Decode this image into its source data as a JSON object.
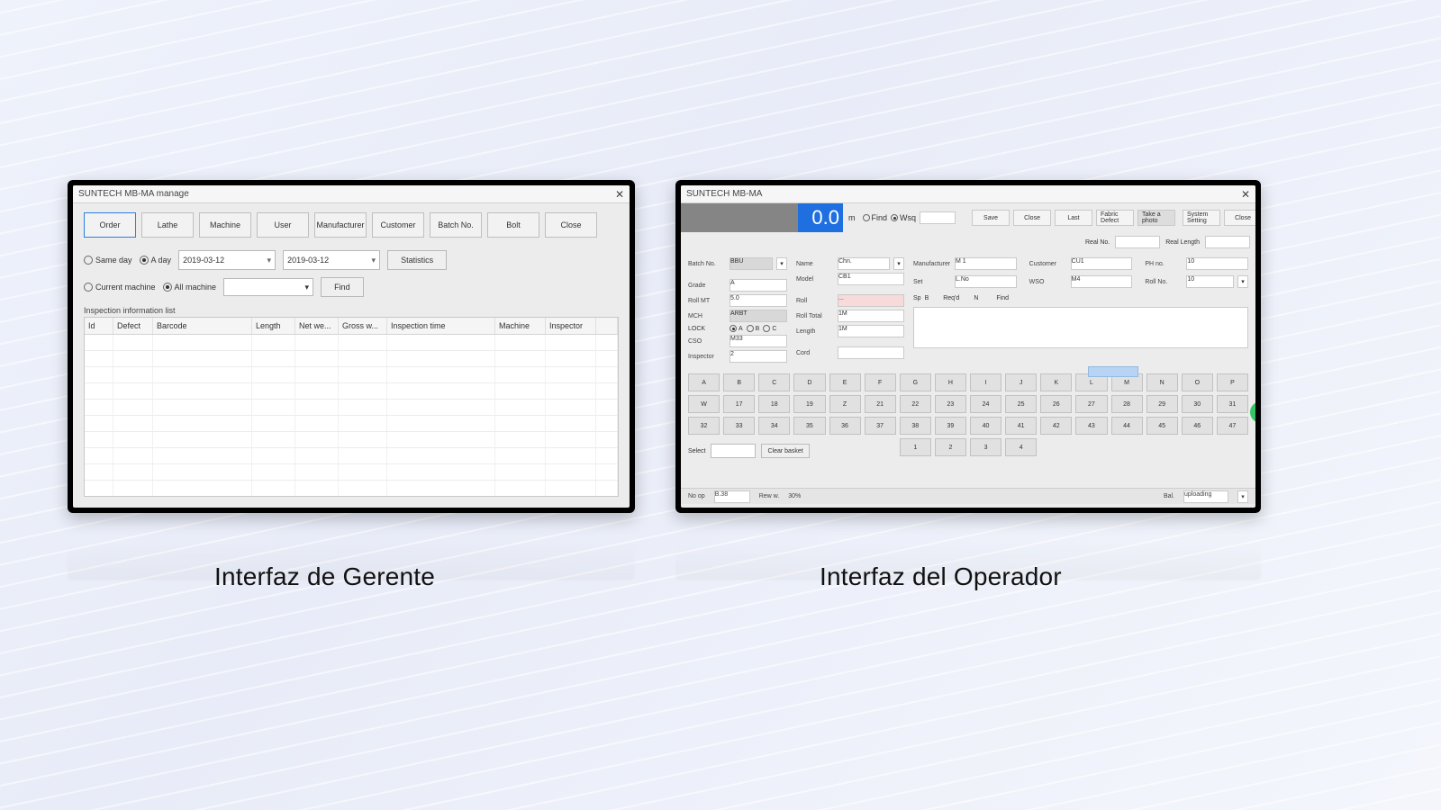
{
  "captions": {
    "manager": "Interfaz de Gerente",
    "operator": "Interfaz del Operador"
  },
  "manager": {
    "title": "SUNTECH MB-MA manage",
    "close_glyph": "✕",
    "toolbar": [
      "Order",
      "Lathe",
      "Machine",
      "User",
      "Manufacturer",
      "Customer",
      "Batch No.",
      "Bolt",
      "Close"
    ],
    "filter": {
      "same_day": "Same day",
      "a_day": "A day",
      "date_from": "2019-03-12",
      "date_to": "2019-03-12",
      "stats": "Statistics",
      "cur_machine": "Current machine",
      "all_machine": "All machine",
      "find": "Find"
    },
    "list_caption": "Inspection information list",
    "columns": [
      "Id",
      "Defect",
      "Barcode",
      "Length",
      "Net we...",
      "Gross w...",
      "Inspection time",
      "Machine",
      "Inspector",
      ""
    ]
  },
  "operator": {
    "title": "SUNTECH MB-MA",
    "counter": "0.0",
    "unit": "m",
    "topbtns": [
      "Save",
      "Close",
      "Last",
      "Fabric Defect",
      "Take a photo",
      "System Setting",
      "Close"
    ],
    "roll_opts": {
      "find": "Find",
      "wsq": "Wsq"
    },
    "bar2": {
      "real_no": "Real No.",
      "real_length": "Real Length"
    },
    "midL": {
      "batch_no": "Batch No.",
      "bbu": "BBU",
      "grade": "Grade",
      "g_val": "A",
      "roll_mt": "Roll MT",
      "rmt_val": "5.0",
      "mch": "MCH",
      "arbt": "ARBT",
      "lock": "LOCK",
      "color": "M33",
      "cso": "CSO",
      "inspector": "Inspector",
      "insp_val": "2"
    },
    "midM": {
      "name": "Name",
      "name_val": "Chn.",
      "model": "Model",
      "model_val": "CB1",
      "roll_label": "Roll",
      "roll_val": "...",
      "roll_total": "Roll Total",
      "rt_val": "1M",
      "length": "Length",
      "len_val": "1M",
      "cord": "Cord"
    },
    "midR1": {
      "manufacturer": "Manufacturer",
      "mf_val": "M 1",
      "set": "Set",
      "set_val": "L.No"
    },
    "midR2": {
      "customer": "Customer",
      "cust_val": "CU1",
      "wso": "WSO",
      "wso_val": "M4"
    },
    "midR3": {
      "ph": "PH no.",
      "ph_val": "10",
      "roll_no": "Roll No.",
      "rn_val": "10"
    },
    "defect_row": {
      "sp": "Sp",
      "b": "B",
      "reqd": "Req'd",
      "n": "N",
      "find": "Find"
    },
    "keys_row1": [
      "A",
      "B",
      "C",
      "D",
      "E",
      "F",
      "G",
      "H",
      "I",
      "J",
      "K",
      "L",
      "M",
      "N",
      "O",
      "P"
    ],
    "keys_row2": [
      "W",
      "17",
      "18",
      "19",
      "Z",
      "21",
      "22",
      "23",
      "24",
      "25",
      "26",
      "27",
      "28",
      "29",
      "30",
      "31"
    ],
    "keys_row3": [
      "32",
      "33",
      "34",
      "35",
      "36",
      "37",
      "38",
      "39",
      "40",
      "41",
      "42",
      "43",
      "44",
      "45",
      "46",
      "47"
    ],
    "keys_row4_a": [
      "Select"
    ],
    "keys_row4_b": [
      "Clear basket"
    ],
    "keys_row4_c": [
      "1",
      "2",
      "3",
      "4"
    ],
    "status": {
      "no_op": "No op",
      "b38": "B.38",
      "rew_w": "Rew w.",
      "pct": "30%",
      "bal": "Bal.",
      "uploading": "uploading"
    }
  }
}
